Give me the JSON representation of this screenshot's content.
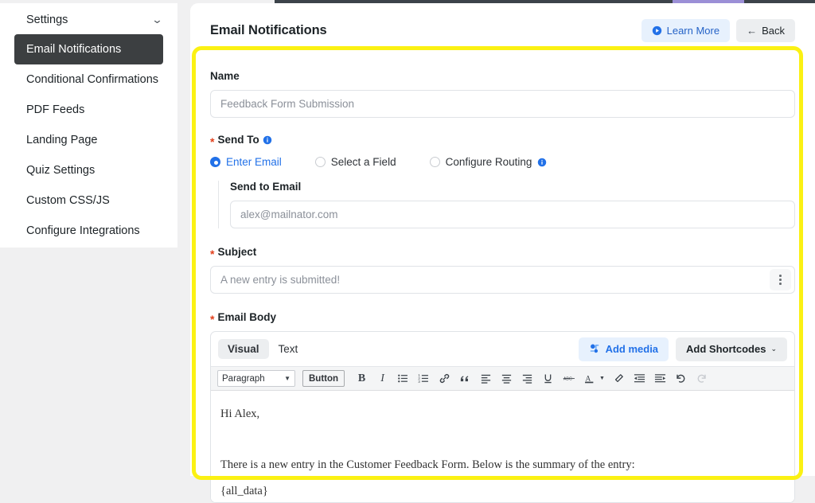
{
  "sidebar": {
    "heading": "Settings",
    "chevron": "chevron-down-icon",
    "items": [
      {
        "label": "Email Notifications",
        "active": true
      },
      {
        "label": "Conditional Confirmations",
        "active": false
      },
      {
        "label": "PDF Feeds",
        "active": false
      },
      {
        "label": "Landing Page",
        "active": false
      },
      {
        "label": "Quiz Settings",
        "active": false
      },
      {
        "label": "Custom CSS/JS",
        "active": false
      },
      {
        "label": "Configure Integrations",
        "active": false
      }
    ]
  },
  "header": {
    "title": "Email Notifications",
    "learn_more_label": "Learn More",
    "back_label": "Back",
    "back_arrow": "←"
  },
  "form": {
    "name_label": "Name",
    "name_value": "Feedback Form Submission",
    "send_to_label": "Send To",
    "send_to_options": [
      {
        "label": "Enter Email",
        "selected": true
      },
      {
        "label": "Select a Field",
        "selected": false
      },
      {
        "label": "Configure Routing",
        "selected": false,
        "has_info": true
      }
    ],
    "send_to_email_label": "Send to Email",
    "send_to_email_value": "alex@mailnator.com",
    "subject_label": "Subject",
    "subject_value": "A new entry is submitted!",
    "email_body_label": "Email Body"
  },
  "editor": {
    "tab_visual": "Visual",
    "tab_text": "Text",
    "add_media_label": "Add media",
    "add_shortcodes_label": "Add Shortcodes",
    "shortcodes_caret": "⌄",
    "format_select_value": "Paragraph",
    "button_tool_label": "Button",
    "bold_label": "B",
    "italic_label": "I",
    "content": {
      "line1": "Hi Alex,",
      "line2": "There is a new entry in the Customer Feedback Form. Below is the summary of the entry:",
      "line3": "{all_data}"
    }
  },
  "colors": {
    "accent_blue": "#2271e8",
    "highlight_yellow": "#fbf113",
    "active_sidebar": "#3c3f41",
    "required_red": "#e2401c"
  }
}
